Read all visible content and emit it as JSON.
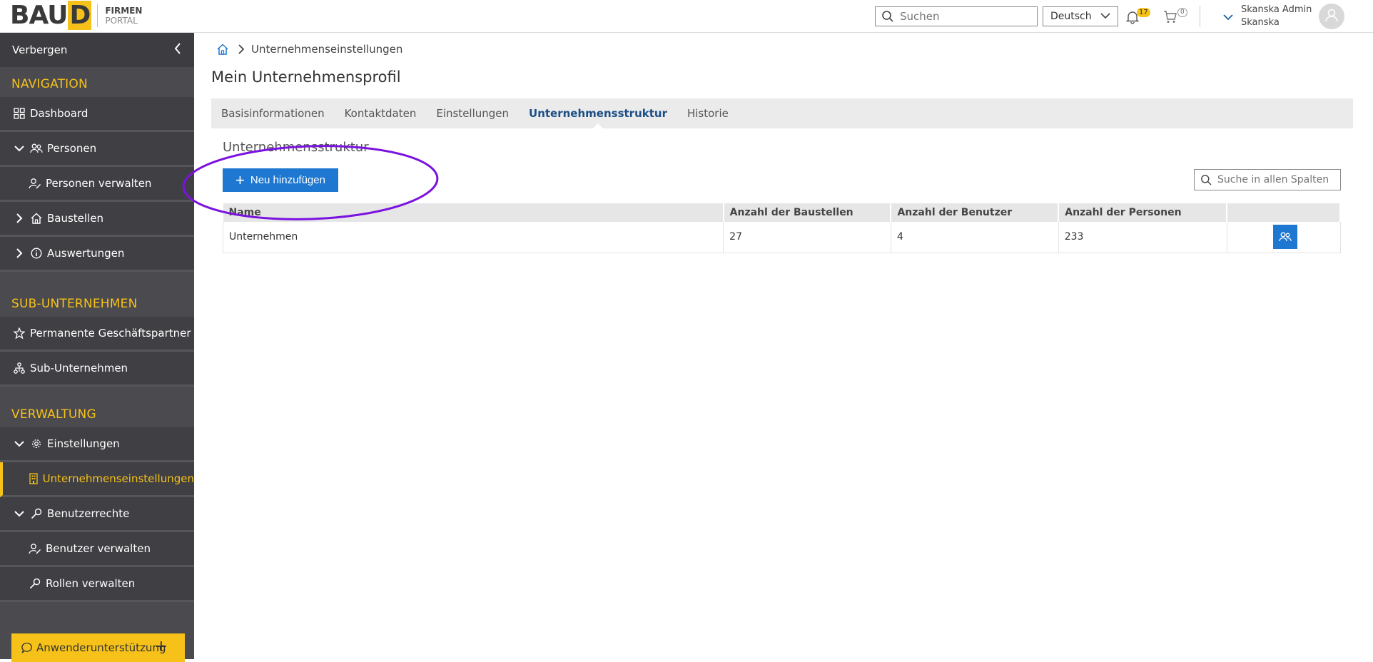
{
  "header": {
    "logo_text": "BAUD",
    "logo_line1": "FIRMEN",
    "logo_line2": "PORTAL",
    "search_placeholder": "Suchen",
    "language": "Deutsch",
    "notifications_count": "17",
    "cart_count": "0",
    "user_name": "Skanska Admin",
    "user_company": "Skanska"
  },
  "sidebar": {
    "hide_label": "Verbergen",
    "sections": {
      "navigation": "NAVIGATION",
      "sub_companies": "SUB-UNTERNEHMEN",
      "administration": "VERWALTUNG"
    },
    "items": {
      "dashboard": "Dashboard",
      "persons": "Personen",
      "manage_persons": "Personen verwalten",
      "construction_sites": "Baustellen",
      "evaluations": "Auswertungen",
      "permanent_partners": "Permanente Geschäftspartner",
      "sub_companies": "Sub-Unternehmen",
      "settings": "Einstellungen",
      "company_settings": "Unternehmenseinstellungen",
      "user_rights": "Benutzerrechte",
      "manage_users": "Benutzer verwalten",
      "manage_roles": "Rollen verwalten"
    },
    "help_label": "Anwenderunterstützung"
  },
  "main": {
    "breadcrumb_current": "Unternehmenseinstellungen",
    "page_title": "Mein Unternehmensprofil",
    "tabs": [
      {
        "label": "Basisinformationen"
      },
      {
        "label": "Kontaktdaten"
      },
      {
        "label": "Einstellungen"
      },
      {
        "label": "Unternehmensstruktur"
      },
      {
        "label": "Historie"
      }
    ],
    "section_title": "Unternehmensstruktur",
    "add_button": "Neu hinzufügen",
    "column_search_placeholder": "Suche in allen Spalten",
    "table": {
      "headers": [
        "Name",
        "Anzahl der Baustellen",
        "Anzahl der Benutzer",
        "Anzahl der Personen",
        ""
      ],
      "rows": [
        {
          "name": "Unternehmen",
          "sites": "27",
          "users": "4",
          "persons": "233"
        }
      ]
    }
  },
  "colors": {
    "accent_yellow": "#f6c21a",
    "primary_blue": "#1e77d0",
    "sidebar_bg": "#4a4a4f",
    "annotation_purple": "#7a12e0"
  }
}
